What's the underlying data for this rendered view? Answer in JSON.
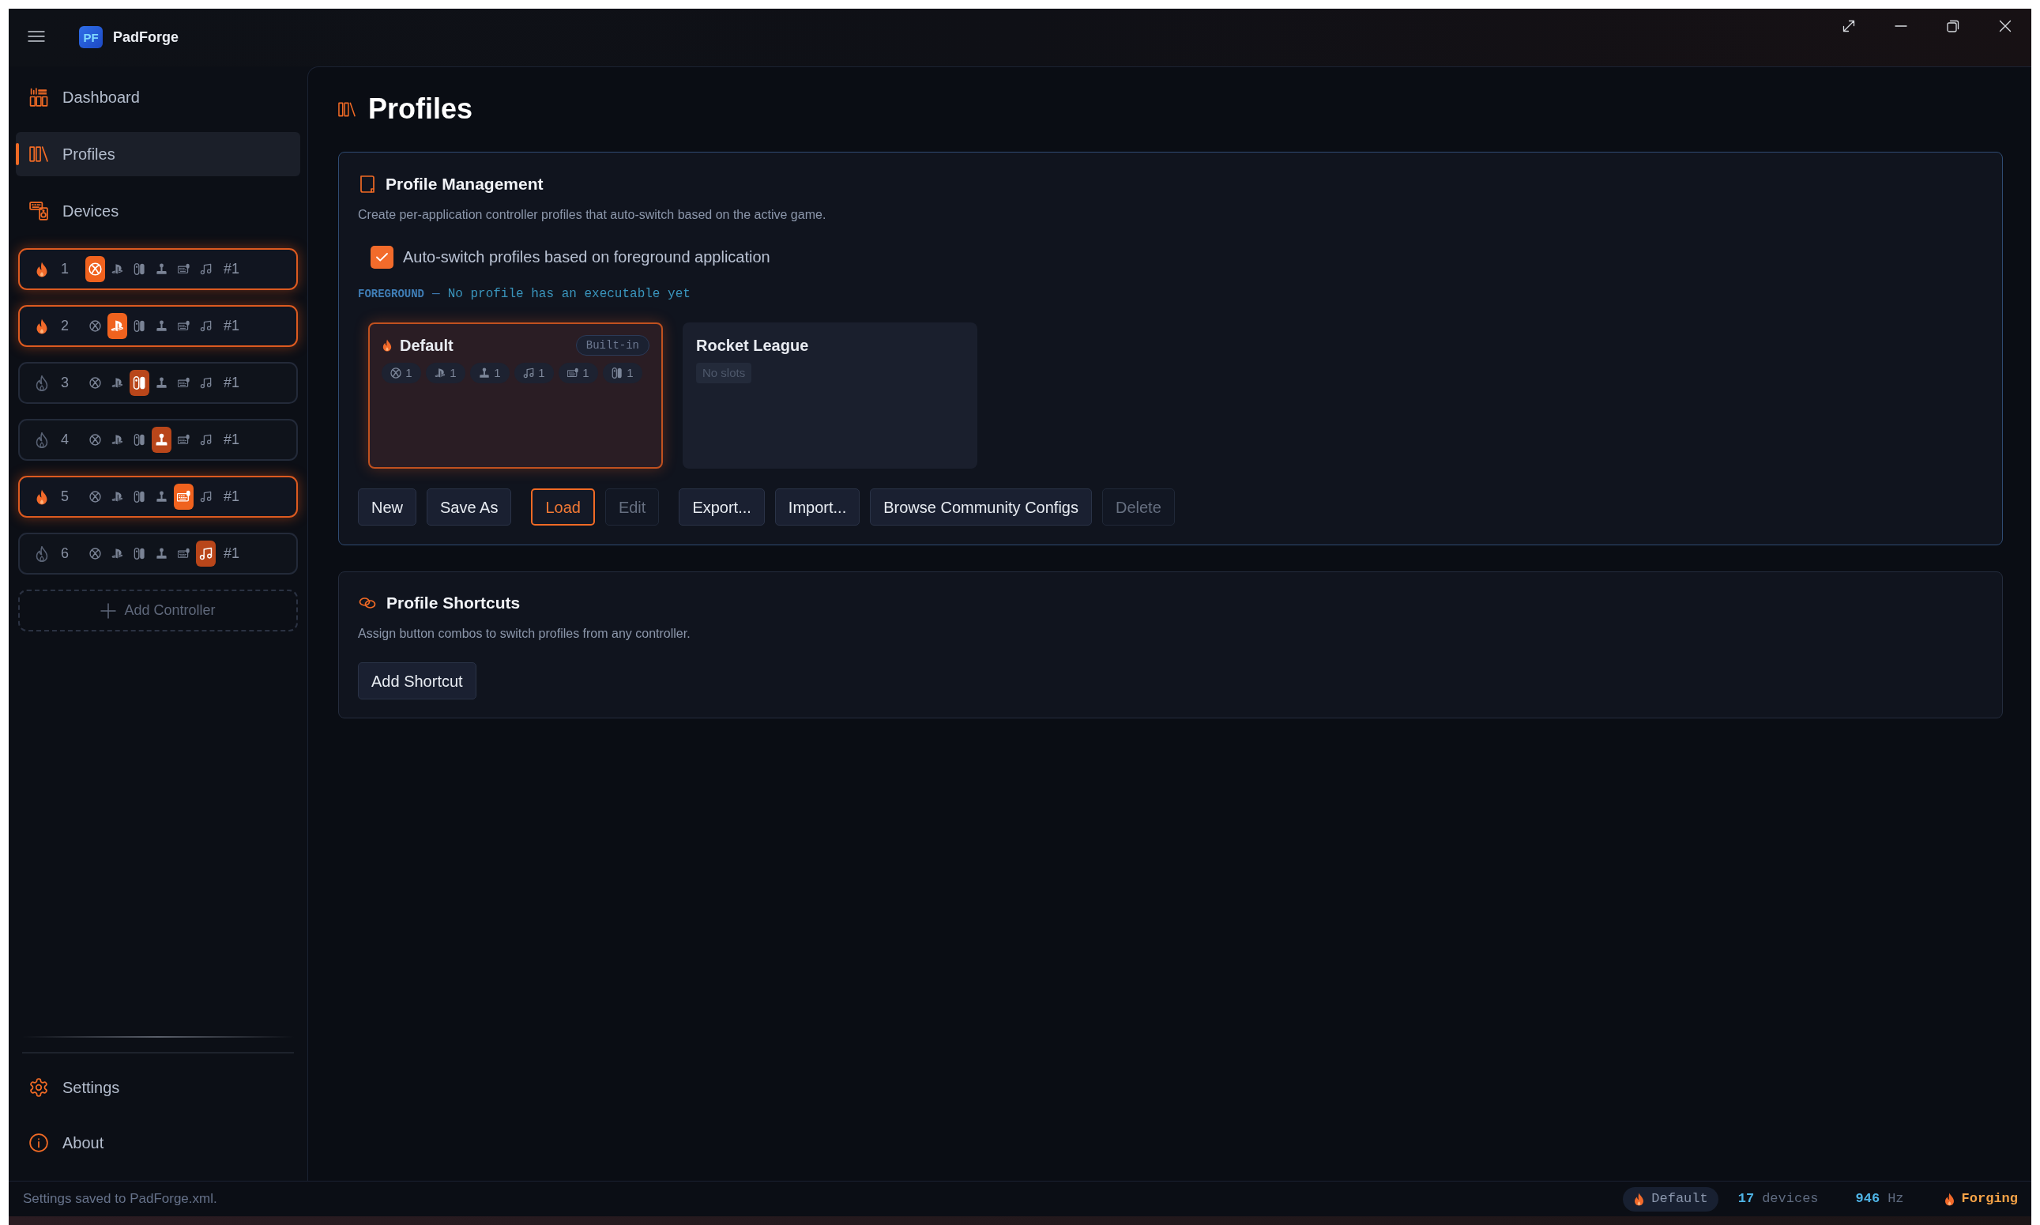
{
  "window": {
    "title": "PadForge",
    "logo_text": "PF"
  },
  "sidebar": {
    "nav": [
      {
        "label": "Dashboard",
        "kind": "dashboard",
        "selected": false
      },
      {
        "label": "Profiles",
        "kind": "profiles",
        "selected": true
      },
      {
        "label": "Devices",
        "kind": "devices",
        "selected": false
      }
    ],
    "controller_slots": [
      {
        "number": "1",
        "active": true,
        "tag": "#1",
        "types": [
          {
            "kind": "orb",
            "selected": true
          },
          {
            "kind": "pmark",
            "selected": false
          },
          {
            "kind": "joycon",
            "selected": false
          },
          {
            "kind": "joystick",
            "selected": false
          },
          {
            "kind": "keyboard",
            "selected": false
          },
          {
            "kind": "notes",
            "selected": false
          }
        ]
      },
      {
        "number": "2",
        "active": true,
        "tag": "#1",
        "types": [
          {
            "kind": "orb",
            "selected": false
          },
          {
            "kind": "pmark",
            "selected": true
          },
          {
            "kind": "joycon",
            "selected": false
          },
          {
            "kind": "joystick",
            "selected": false
          },
          {
            "kind": "keyboard",
            "selected": false
          },
          {
            "kind": "notes",
            "selected": false
          }
        ]
      },
      {
        "number": "3",
        "active": false,
        "tag": "#1",
        "types": [
          {
            "kind": "orb",
            "selected": false
          },
          {
            "kind": "pmark",
            "selected": false
          },
          {
            "kind": "joycon",
            "selected": true
          },
          {
            "kind": "joystick",
            "selected": false
          },
          {
            "kind": "keyboard",
            "selected": false
          },
          {
            "kind": "notes",
            "selected": false
          }
        ]
      },
      {
        "number": "4",
        "active": false,
        "tag": "#1",
        "types": [
          {
            "kind": "orb",
            "selected": false
          },
          {
            "kind": "pmark",
            "selected": false
          },
          {
            "kind": "joycon",
            "selected": false
          },
          {
            "kind": "joystick",
            "selected": true
          },
          {
            "kind": "keyboard",
            "selected": false
          },
          {
            "kind": "notes",
            "selected": false
          }
        ]
      },
      {
        "number": "5",
        "active": true,
        "tag": "#1",
        "types": [
          {
            "kind": "orb",
            "selected": false
          },
          {
            "kind": "pmark",
            "selected": false
          },
          {
            "kind": "joycon",
            "selected": false
          },
          {
            "kind": "joystick",
            "selected": false
          },
          {
            "kind": "keyboard",
            "selected": true
          },
          {
            "kind": "notes",
            "selected": false
          }
        ]
      },
      {
        "number": "6",
        "active": false,
        "tag": "#1",
        "types": [
          {
            "kind": "orb",
            "selected": false
          },
          {
            "kind": "pmark",
            "selected": false
          },
          {
            "kind": "joycon",
            "selected": false
          },
          {
            "kind": "joystick",
            "selected": false
          },
          {
            "kind": "keyboard",
            "selected": false
          },
          {
            "kind": "notes",
            "selected": true
          }
        ]
      }
    ],
    "add_controller": {
      "label": "Add Controller"
    },
    "footer_nav": [
      {
        "label": "Settings",
        "kind": "settings"
      },
      {
        "label": "About",
        "kind": "about"
      }
    ]
  },
  "page": {
    "title": "Profiles"
  },
  "profile_management": {
    "title": "Profile Management",
    "description": "Create per-application controller profiles that auto-switch based on the active game.",
    "auto_switch": {
      "label": "Auto-switch profiles based on foreground application",
      "checked": true
    },
    "foreground": {
      "label": "FOREGROUND",
      "separator": "—",
      "message": "No profile has an executable yet"
    },
    "profiles": [
      {
        "name": "Default",
        "selected": true,
        "badge": "Built-in",
        "slots": [
          {
            "kind": "orb",
            "count": "1"
          },
          {
            "kind": "pmark",
            "count": "1"
          },
          {
            "kind": "joystick",
            "count": "1"
          },
          {
            "kind": "notes",
            "count": "1"
          },
          {
            "kind": "keyboard",
            "count": "1"
          },
          {
            "kind": "joycon",
            "count": "1"
          }
        ]
      },
      {
        "name": "Rocket League",
        "selected": false,
        "empty_label": "No slots"
      }
    ],
    "button_groups": [
      [
        {
          "label": "New",
          "primary": false,
          "disabled": false
        },
        {
          "label": "Save As",
          "primary": false,
          "disabled": false
        }
      ],
      [
        {
          "label": "Load",
          "primary": true,
          "disabled": false
        },
        {
          "label": "Edit",
          "primary": false,
          "disabled": true
        }
      ],
      [
        {
          "label": "Export...",
          "primary": false,
          "disabled": false
        },
        {
          "label": "Import...",
          "primary": false,
          "disabled": false
        },
        {
          "label": "Browse Community Configs",
          "primary": false,
          "disabled": false
        },
        {
          "label": "Delete",
          "primary": false,
          "disabled": true
        }
      ]
    ]
  },
  "profile_shortcuts": {
    "title": "Profile Shortcuts",
    "description": "Assign button combos to switch profiles from any controller.",
    "buttons": [
      {
        "label": "Add Shortcut",
        "primary": false,
        "disabled": false
      }
    ]
  },
  "status_bar": {
    "message": "Settings saved to PadForge.xml.",
    "profile": "Default",
    "devices": {
      "value": "17",
      "unit": "devices"
    },
    "rate": {
      "value": "946",
      "unit": "Hz"
    },
    "engine": "Forging"
  }
}
